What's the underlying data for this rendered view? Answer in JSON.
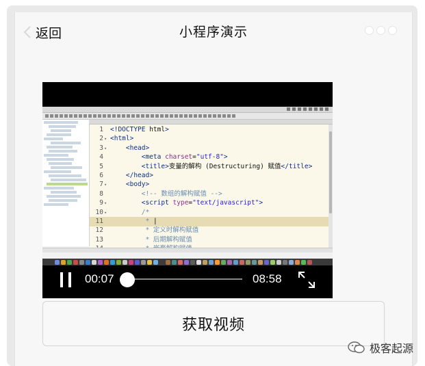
{
  "navbar": {
    "back_label": "返回",
    "title": "小程序演示"
  },
  "video": {
    "current_time": "00:07",
    "duration": "08:58",
    "progress": 0.013,
    "state": "playing",
    "code_lines": [
      {
        "n": "1",
        "m": "",
        "parts": [
          [
            "t-tag",
            "<!DOCTYPE "
          ],
          [
            "t-txt",
            "html"
          ],
          [
            "t-tag",
            ">"
          ]
        ]
      },
      {
        "n": "2",
        "m": "▾",
        "parts": [
          [
            "t-tag",
            "<html>"
          ]
        ]
      },
      {
        "n": "3",
        "m": "▾",
        "parts": [
          [
            "t-txt",
            "    "
          ],
          [
            "t-tag",
            "<head>"
          ]
        ]
      },
      {
        "n": "4",
        "m": "",
        "parts": [
          [
            "t-txt",
            "        "
          ],
          [
            "t-tag",
            "<meta "
          ],
          [
            "t-attr",
            "charset"
          ],
          [
            "t-txt",
            "="
          ],
          [
            "t-str",
            "\"utf-8\""
          ],
          [
            "t-tag",
            ">"
          ]
        ]
      },
      {
        "n": "5",
        "m": "",
        "parts": [
          [
            "t-txt",
            "        "
          ],
          [
            "t-tag",
            "<title>"
          ],
          [
            "t-txt",
            "变量的解构 (Destructuring) 赋值"
          ],
          [
            "t-tag",
            "</title>"
          ]
        ]
      },
      {
        "n": "6",
        "m": "",
        "parts": [
          [
            "t-txt",
            "    "
          ],
          [
            "t-tag",
            "</head>"
          ]
        ]
      },
      {
        "n": "7",
        "m": "▾",
        "parts": [
          [
            "t-txt",
            "    "
          ],
          [
            "t-tag",
            "<body>"
          ]
        ]
      },
      {
        "n": "8",
        "m": "",
        "parts": [
          [
            "t-txt",
            "        "
          ],
          [
            "t-com",
            "<!-- 数组的解构赋值 -->"
          ]
        ]
      },
      {
        "n": "9",
        "m": "▾",
        "parts": [
          [
            "t-txt",
            "        "
          ],
          [
            "t-tag",
            "<script "
          ],
          [
            "t-attr",
            "type"
          ],
          [
            "t-txt",
            "="
          ],
          [
            "t-str",
            "\"text/javascript\""
          ],
          [
            "t-tag",
            ">"
          ]
        ]
      },
      {
        "n": "10",
        "m": "▾",
        "parts": [
          [
            "t-txt",
            "        "
          ],
          [
            "t-com",
            "/*"
          ]
        ]
      },
      {
        "n": "11",
        "m": "",
        "parts": [
          [
            "t-txt",
            "         "
          ],
          [
            "t-com",
            "* "
          ],
          [
            "t-txt",
            "|"
          ]
        ],
        "active": true
      },
      {
        "n": "12",
        "m": "",
        "parts": [
          [
            "t-txt",
            "         "
          ],
          [
            "t-com",
            "* 定义时解构赋值"
          ]
        ]
      },
      {
        "n": "13",
        "m": "",
        "parts": [
          [
            "t-txt",
            "         "
          ],
          [
            "t-com",
            "* 后期解构赋值"
          ]
        ]
      },
      {
        "n": "14",
        "m": "",
        "parts": [
          [
            "t-txt",
            "         "
          ],
          [
            "t-com",
            "* 嵌套解构赋值"
          ]
        ]
      }
    ],
    "dock_colors": [
      "#6c8fd6",
      "#e0a030",
      "#4aa84a",
      "#c94c4c",
      "#8a8a8a",
      "#3b7bd4",
      "#d6d6d6",
      "#b05fc9",
      "#e06f2a",
      "#2f9fd0",
      "#7fb13b",
      "#c9c9c9",
      "#d04080",
      "#5b5bd6",
      "#999999",
      "#e3c14a",
      "#6fb0e0",
      "#3c3c3c",
      "#a07040",
      "#4c8c8c",
      "#d66",
      "#8c6cd6",
      "#5c5c5c",
      "#e0e0e0",
      "#c0a060",
      "#70a0d0",
      "#ff9933",
      "#66aa66",
      "#aa66aa",
      "#6699cc",
      "#cc6666",
      "#999966",
      "#669999",
      "#cc9966",
      "#6666cc",
      "#99cc66",
      "#cccccc",
      "#777777",
      "#88aadd",
      "#dd8844",
      "#55bb55",
      "#bb5555"
    ]
  },
  "action": {
    "button_label": "获取视频"
  },
  "watermark": {
    "text": "极客起源"
  },
  "colors": {
    "screen_bg": "#f7f7f7",
    "frame_bg": "#e9e9e9",
    "video_bg": "#000000"
  }
}
